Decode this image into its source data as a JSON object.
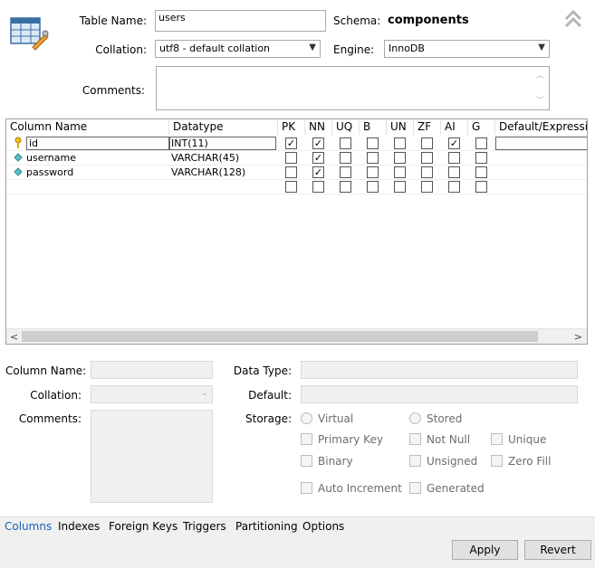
{
  "header": {
    "table_name_label": "Table Name:",
    "table_name_value": "users",
    "schema_label": "Schema:",
    "schema_value": "components",
    "collation_label": "Collation:",
    "collation_value": "utf8 - default collation",
    "engine_label": "Engine:",
    "engine_value": "InnoDB",
    "comments_label": "Comments:",
    "comments_value": ""
  },
  "grid": {
    "columns": [
      "Column Name",
      "Datatype",
      "PK",
      "NN",
      "UQ",
      "B",
      "UN",
      "ZF",
      "AI",
      "G",
      "Default/Expression"
    ],
    "rows": [
      {
        "name": "id",
        "datatype": "INT(11)",
        "pk": true,
        "nn": true,
        "uq": false,
        "b": false,
        "un": false,
        "zf": false,
        "ai": true,
        "g": false,
        "icon": "primary-key-icon"
      },
      {
        "name": "username",
        "datatype": "VARCHAR(45)",
        "pk": false,
        "nn": true,
        "uq": false,
        "b": false,
        "un": false,
        "zf": false,
        "ai": false,
        "g": false,
        "icon": "column-diamond-icon"
      },
      {
        "name": "password",
        "datatype": "VARCHAR(128)",
        "pk": false,
        "nn": true,
        "uq": false,
        "b": false,
        "un": false,
        "zf": false,
        "ai": false,
        "g": false,
        "icon": "column-diamond-icon"
      }
    ]
  },
  "details": {
    "column_name_label": "Column Name:",
    "collation_label": "Collation:",
    "comments_label": "Comments:",
    "data_type_label": "Data Type:",
    "default_label": "Default:",
    "storage_label": "Storage:",
    "virtual_label": "Virtual",
    "stored_label": "Stored",
    "primary_key_label": "Primary Key",
    "not_null_label": "Not Null",
    "unique_label": "Unique",
    "binary_label": "Binary",
    "unsigned_label": "Unsigned",
    "zero_fill_label": "Zero Fill",
    "auto_increment_label": "Auto Increment",
    "generated_label": "Generated"
  },
  "tabs": [
    "Columns",
    "Indexes",
    "Foreign Keys",
    "Triggers",
    "Partitioning",
    "Options"
  ],
  "active_tab": "Columns",
  "buttons": {
    "apply": "Apply",
    "revert": "Revert"
  },
  "colors": {
    "active_tab": "#1a5fb4",
    "panel_bg": "#f0f0f0"
  }
}
